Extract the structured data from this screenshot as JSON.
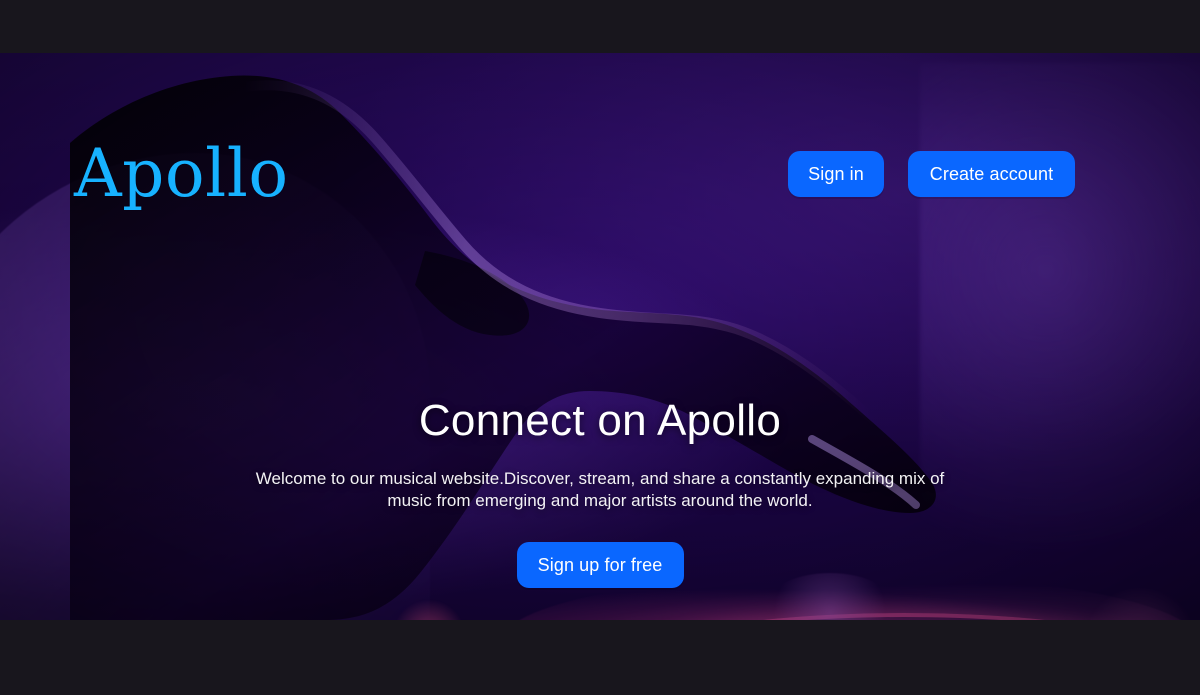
{
  "brand": {
    "name": "Apollo",
    "color": "#17b2ff"
  },
  "nav": {
    "sign_in": "Sign in",
    "create_account": "Create account",
    "button_color": "#0a67ff"
  },
  "hero": {
    "headline": "Connect on Apollo",
    "description": "Welcome to our musical website.Discover, stream, and share a constantly expanding mix of music from emerging and major artists around the world.",
    "cta": "Sign up for free"
  },
  "background": {
    "image": "purple-dj-hand-on-turntable"
  }
}
